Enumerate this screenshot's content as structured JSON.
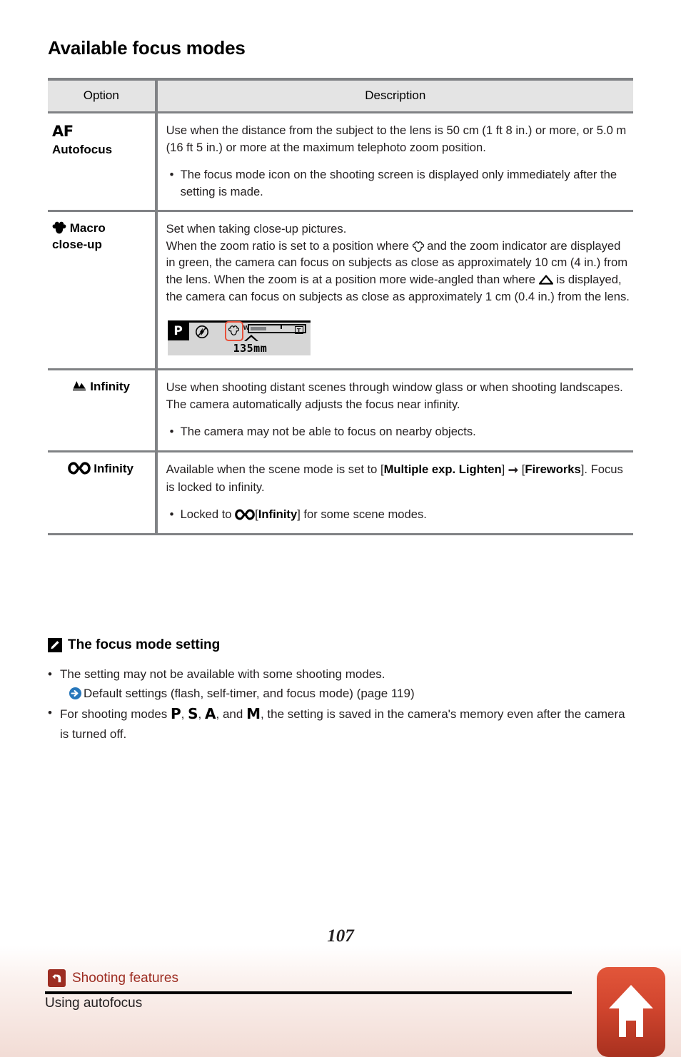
{
  "document": {
    "title": "Available focus modes",
    "page_number": "107"
  },
  "table": {
    "headers": {
      "option": "Option",
      "description": "Description"
    },
    "rows": [
      {
        "icon": "af-icon",
        "icon_text": "AF",
        "option_label": "Autofocus",
        "description_paragraphs": [
          "Use when the distance from the subject to the lens is 50 cm (1 ft 8 in.) or more, or 5.0 m (16 ft 5 in.) or more at the maximum telephoto zoom position."
        ],
        "bullets": [
          "The focus mode icon on the shooting screen is displayed only immediately after the setting is made."
        ]
      },
      {
        "icon": "tulip-macro-icon",
        "option_label_line1": "Macro",
        "option_label_line2": "close-up",
        "description_paragraphs": [
          "Set when taking close-up pictures.",
          "When the zoom ratio is set to a position where  and the zoom indicator are displayed in green, the camera can focus on subjects as close as approximately 10 cm (4 in.) from the lens. When the zoom is at a position more wide-angled than where  is displayed, the camera can focus on subjects as close as approximately 1 cm (0.4 in.) from the lens."
        ],
        "desc_part_1": "When the zoom ratio is set to a position where",
        "desc_part_2": "and the zoom indicator are displayed in green, the camera can focus on subjects as close as approximately 10 cm (4 in.) from the lens. When the zoom is at a position more wide-angled than where",
        "desc_part_3": "is displayed, the camera can focus on subjects as close as approximately 1 cm (0.4 in.) from the lens.",
        "illustration": {
          "mode_label": "P",
          "zoom_focal_length": "135mm",
          "wide_label": "W",
          "tele_label": "T",
          "highlight_color": "#e8503a"
        }
      },
      {
        "icon": "mountain-infinity-icon",
        "option_label": "Infinity",
        "description_paragraphs": [
          "Use when shooting distant scenes through window glass or when shooting landscapes.",
          "The camera automatically adjusts the focus near infinity."
        ],
        "bullets": [
          "The camera may not be able to focus on nearby objects."
        ]
      },
      {
        "icon": "infinity-symbol-icon",
        "option_label": "Infinity",
        "desc_a": "Available when the scene mode is set to [",
        "desc_bold_1": "Multiple exp. Lighten",
        "desc_b": "]",
        "desc_c": "[",
        "desc_bold_2": "Fireworks",
        "desc_d": "]. Focus is locked to infinity.",
        "bullet_a": "Locked to",
        "bullet_b": "[",
        "bullet_bold": "Infinity",
        "bullet_c": "] for some scene modes."
      }
    ]
  },
  "note": {
    "icon": "pencil-note-icon",
    "title": "The focus mode setting",
    "items": [
      {
        "text": "The setting may not be available with some shooting modes.",
        "reference": "Default settings (flash, self-timer, and focus mode) (page 119)",
        "reference_icon": "blue-arrow-icon"
      },
      {
        "text_a": "For shooting modes",
        "modes": [
          "P",
          "S",
          "A",
          "M"
        ],
        "text_b": ", the setting is saved in the camera's memory even after the camera is turned off.",
        "separator": ",",
        "and_word": "and"
      }
    ]
  },
  "footer": {
    "breadcrumb_icon": "back-arrow-icon",
    "breadcrumb_label": "Shooting features",
    "breadcrumb_sub": "Using autofocus",
    "home_button_icon": "home-icon",
    "accent_color": "#9d2d22"
  }
}
